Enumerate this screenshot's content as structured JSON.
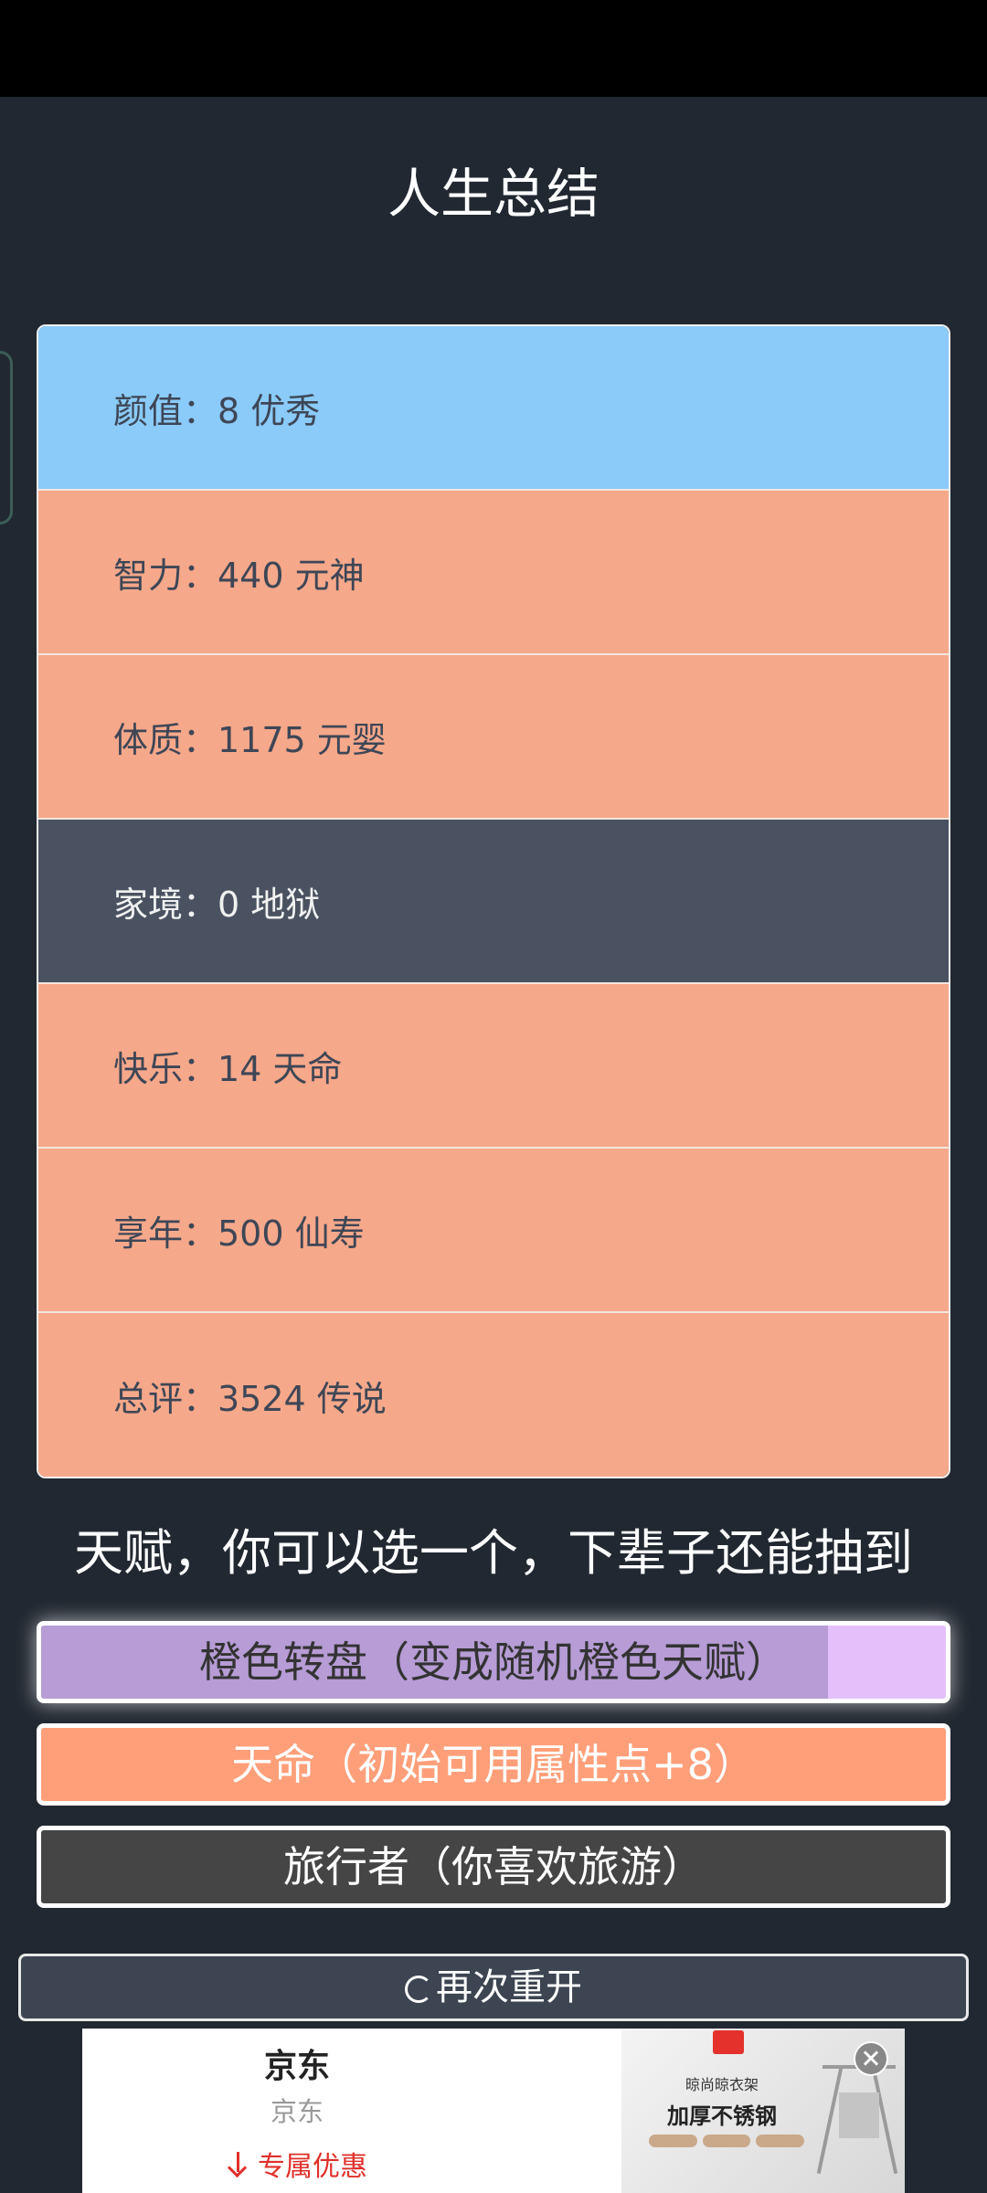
{
  "header": {
    "title": "人生总结"
  },
  "summary": {
    "rows": [
      {
        "label": "颜值：8 优秀",
        "color": "#8acbf9"
      },
      {
        "label": "智力：440 元神",
        "color": "#f6a88a"
      },
      {
        "label": "体质：1175 元婴",
        "color": "#f6a88a"
      },
      {
        "label": "家境：0 地狱",
        "color": "#4a5262"
      },
      {
        "label": "快乐：14 天命",
        "color": "#f6a88a"
      },
      {
        "label": "享年：500 仙寿",
        "color": "#f6a88a"
      },
      {
        "label": "总评：3524 传说",
        "color": "#f6a88a"
      }
    ]
  },
  "talents": {
    "heading": "天赋，你可以选一个，下辈子还能抽到",
    "items": [
      {
        "label": "橙色转盘（变成随机橙色天赋）",
        "color": "#e4c0fb",
        "progress": 0.87
      },
      {
        "label": "天命（初始可用属性点+8）",
        "color": "#ff9f7a"
      },
      {
        "label": "旅行者（你喜欢旅游）",
        "color": "#454545"
      }
    ]
  },
  "restart": {
    "label": "再次重开",
    "icon": "refresh-icon"
  },
  "ad": {
    "brand": "京东",
    "subtitle": "京东",
    "cta": "专属优惠",
    "cta_icon": "download-icon",
    "image_small_text": "晾尚晾衣架",
    "image_big_text": "加厚不锈钢",
    "close_icon": "close-icon"
  }
}
